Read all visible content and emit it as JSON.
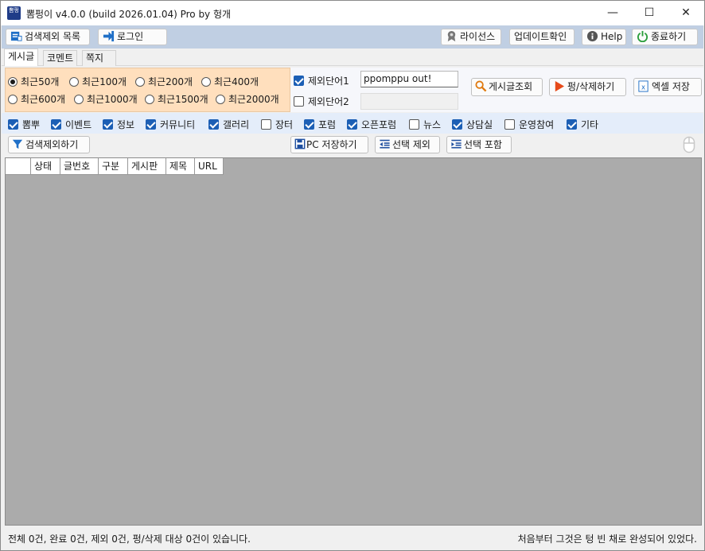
{
  "window": {
    "title": "뽐펑이 v4.0.0 (build 2026.01.04) Pro by 헝개",
    "icon_text": "뽐펑",
    "minimize": "—",
    "maximize": "☐",
    "close": "✕"
  },
  "toolbar": {
    "exclude_list": "검색제외 목록",
    "login": "로그인",
    "license": "라이선스",
    "update": "업데이트확인",
    "help": "Help",
    "exit": "종료하기"
  },
  "tabs": [
    "게시글",
    "코멘트",
    "쪽지"
  ],
  "recent": {
    "options": [
      "최근50개",
      "최근100개",
      "최근200개",
      "최근400개",
      "최근600개",
      "최근1000개",
      "최근1500개",
      "최근2000개"
    ],
    "selected": "최근50개"
  },
  "exclude": {
    "word1_label": "제외단어1",
    "word1_value": "ppomppu out!",
    "word2_label": "제외단어2",
    "word2_value": ""
  },
  "actions": {
    "search": "게시글조회",
    "pung_delete": "펑/삭제하기",
    "excel": "엑셀 저장"
  },
  "categories": [
    {
      "label": "뽐뿌",
      "checked": true
    },
    {
      "label": "이벤트",
      "checked": true
    },
    {
      "label": "정보",
      "checked": true
    },
    {
      "label": "커뮤니티",
      "checked": true
    },
    {
      "label": "갤러리",
      "checked": true
    },
    {
      "label": "장터",
      "checked": false
    },
    {
      "label": "포럼",
      "checked": true
    },
    {
      "label": "오픈포럼",
      "checked": true
    },
    {
      "label": "뉴스",
      "checked": false
    },
    {
      "label": "상담실",
      "checked": true
    },
    {
      "label": "운영참여",
      "checked": false
    },
    {
      "label": "기타",
      "checked": true
    }
  ],
  "bar2": {
    "exclude_search": "검색제외하기",
    "pc_save": "PC 저장하기",
    "sel_exclude": "선택 제외",
    "sel_include": "선택 포함"
  },
  "columns": [
    "",
    "상태",
    "글번호",
    "구분",
    "게시판",
    "제목",
    "URL"
  ],
  "status": {
    "left": "전체 0건, 완료 0건, 제외 0건, 펑/삭제 대상 0건이 있습니다.",
    "right": "처음부터 그것은 텅 빈 채로 완성되어 있었다."
  },
  "colors": {
    "toolbar_bg": "#c0cfe3",
    "options_bg": "#ffdfbd",
    "category_bg": "#e4edfa",
    "grid_bg": "#ababab",
    "check_blue": "#1c5fb5"
  }
}
